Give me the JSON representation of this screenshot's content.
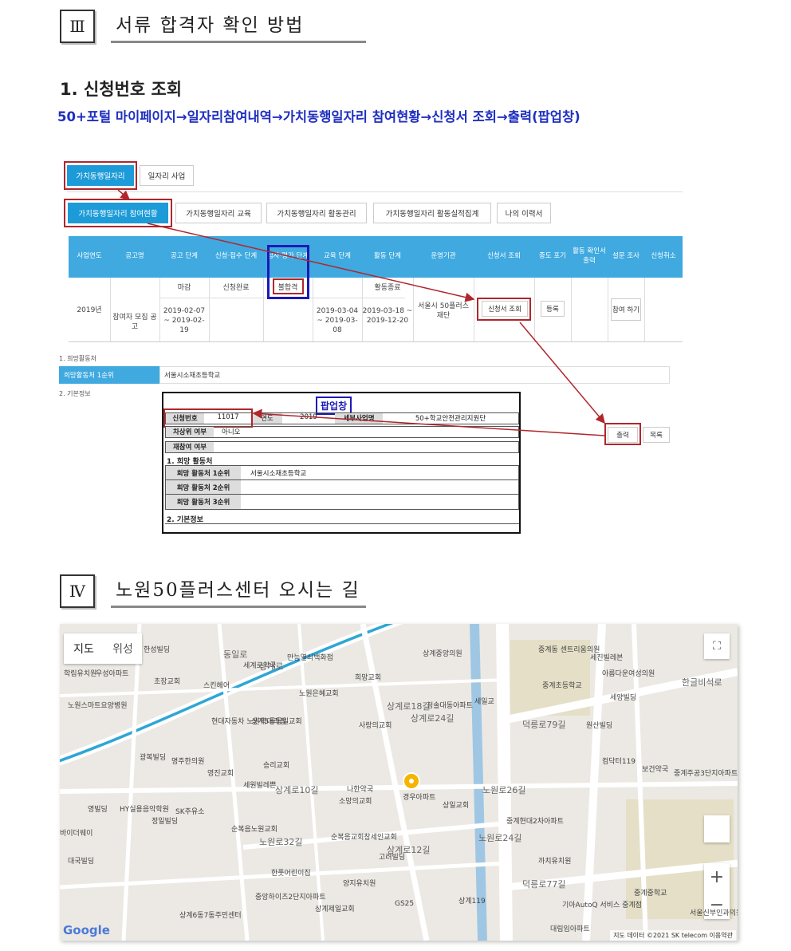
{
  "sec3": {
    "roman": "Ⅲ",
    "title": "서류 합격자 확인 방법"
  },
  "sub1": "1. 신청번호 조회",
  "path": "50+포털 마이페이지→일자리참여내역→가치동행일자리 참여현황→신청서 조회→출력(팝업창)",
  "shot": {
    "tab1": "가치동행일자리",
    "tab2": "일자리 사업",
    "subtabs": [
      "가치동행일자리 참여현황",
      "가치동행일자리 교육",
      "가치동행일자리 활동관리",
      "가치동행일자리 활동실적집계",
      "나의 이력서"
    ],
    "headers": [
      "사업연도",
      "공고명",
      "공고 단계",
      "신청·접수 단계",
      "심사·평가 단계",
      "교육 단계",
      "활동 단계",
      "운영기관",
      "신청서 조회",
      "중도 포기",
      "활동 확인서 출력",
      "설문 조사",
      "신청취소"
    ],
    "row": {
      "year": "2019년",
      "title": "참여자 모집 공고",
      "notice_stage": "마감",
      "notice_dates": "2019-02-07 ~ 2019-02-19",
      "apply_stage": "신청완료",
      "eval_stage": "불합격",
      "edu_dates": "2019-03-04 ~ 2019-03-08",
      "act_stage": "활동종료",
      "act_dates": "2019-03-18 ~ 2019-12-20",
      "org": "서울시 50플러스재단",
      "view_btn": "신청서 조회",
      "quit_btn": "등록",
      "survey_btn": "참여 하기"
    },
    "hope_label": "1. 희망활동처",
    "hope_row_label": "희망활동처 1순위",
    "hope_row_value": "서울시소재초등학교",
    "basic_label": "2. 기본정보",
    "print_btn": "출력",
    "list_btn": "목록"
  },
  "popup": {
    "title": "팝업창",
    "appno_label": "신청번호",
    "appno": "11017",
    "year_label": "연도",
    "year": "2019",
    "biz_label": "세부사업명",
    "biz": "50+학교안전관리지원단",
    "upper_label": "차상위 여부",
    "upper": "아니오",
    "rejoin_label": "재참여 여부",
    "hope_title": "1. 희망 활동처",
    "hope1_label": "희망 활동처 1순위",
    "hope1": "서울시소재초등학교",
    "hope2_label": "희망 활동처 2순위",
    "hope3_label": "희망 활동처 3순위",
    "basic_title": "2. 기본정보"
  },
  "sec4": {
    "roman": "Ⅳ",
    "title": "노원50플러스센터 오시는 길"
  },
  "map": {
    "btn_map": "지도",
    "btn_sat": "위성",
    "zoom_in": "+",
    "zoom_out": "−",
    "google": "Google",
    "attribution": "지도 데이터 ©2021 SK telecom   이용약관",
    "labels": [
      "한성빌딩",
      "우성아파트",
      "학림유치원",
      "초장교회",
      "스킨헤어",
      "노원스마트요양병원",
      "세계로약국",
      "만능열쇠백화점",
      "희망교회",
      "노원은혜교회",
      "상계중앙의원",
      "청솔대동아파트",
      "세일교",
      "중계동 센트리움의원",
      "세진빌레븐",
      "아름다운여성의원",
      "중계초등학교",
      "세양빌딩",
      "현대자동차 노원역대리점",
      "상계5동동일교회",
      "사랑의교회",
      "원산빌딩",
      "광복빌딩",
      "명주한의원",
      "영진교회",
      "승리교회",
      "세원빌레쁜",
      "나한약국",
      "경우아파트",
      "상일교회",
      "컴닥터119",
      "보건약국",
      "중계주공3단지아파트",
      "소망의교회",
      "HY실용음악학원",
      "영빌딩",
      "정일빌딩",
      "바이더웨이",
      "SK주유소",
      "순복음노원교회",
      "순복음교회창세인교회",
      "중계현대2차아파트",
      "까치유치원",
      "고려빌딩",
      "한풋어린이집",
      "양지유치원",
      "중앙하이츠2단지아파트",
      "상계제일교회",
      "상계6동7동주민센터",
      "GS25",
      "상계119",
      "기아AutoQ 서비스 중계점",
      "대림임아파트",
      "중계중학교",
      "서울신부인과의원",
      "대국빌딩"
    ],
    "roads": [
      "상계로",
      "동일로",
      "상계로10길",
      "상계로18길",
      "상계로24길",
      "노원로32길",
      "상계로12길",
      "노원로26길",
      "노원로24길",
      "덕릉로77길",
      "덕릉로79길",
      "한글비석로"
    ]
  }
}
